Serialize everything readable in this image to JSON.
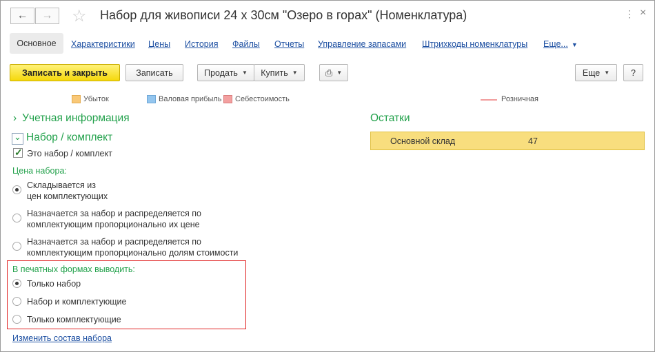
{
  "window": {
    "title": "Набор для живописи 24 х 30см \"Озеро в горах\" (Номенклатура)"
  },
  "tabs": [
    {
      "label": "Основное"
    },
    {
      "label": "Характеристики"
    },
    {
      "label": "Цены"
    },
    {
      "label": "История"
    },
    {
      "label": "Файлы"
    },
    {
      "label": "Отчеты"
    },
    {
      "label": "Управление запасами"
    },
    {
      "label": "Штрихкоды номенклатуры"
    },
    {
      "label": "Еще..."
    }
  ],
  "toolbar": {
    "save_close": "Записать и закрыть",
    "save": "Записать",
    "sell": "Продать",
    "buy": "Купить",
    "more": "Еще",
    "help": "?"
  },
  "legend": {
    "items": [
      {
        "label": "Убыток",
        "color": "#f9c877"
      },
      {
        "label": "Валовая прибыль",
        "color": "#94c6ef"
      },
      {
        "label": "Себестоимость",
        "color": "#f3a0a0"
      }
    ],
    "line_label": "Розничная",
    "line_color": "#f19b9b"
  },
  "accounting": {
    "heading": "Учетная информация"
  },
  "kit": {
    "heading": "Набор / комплект",
    "is_kit_label": "Это набор / комплект",
    "is_kit_checked": true,
    "price_label": "Цена набора:",
    "price_options": [
      {
        "line1": "Складывается из",
        "line2": "цен комплектующих",
        "selected": true
      },
      {
        "line1": "Назначается за набор и распределяется по",
        "line2": "комплектующим пропорционально их цене",
        "selected": false
      },
      {
        "line1": "Назначается за набор и распределяется по",
        "line2": "комплектующим пропорционально долям стоимости",
        "selected": false
      }
    ],
    "print_label": "В печатных формах выводить:",
    "print_options": [
      {
        "label": "Только набор",
        "selected": true
      },
      {
        "label": "Набор и комплектующие",
        "selected": false
      },
      {
        "label": "Только комплектующие",
        "selected": false
      }
    ],
    "change_link": "Изменить состав набора"
  },
  "stock": {
    "heading": "Остатки",
    "warehouse": "Основной склад",
    "quantity": "47"
  }
}
